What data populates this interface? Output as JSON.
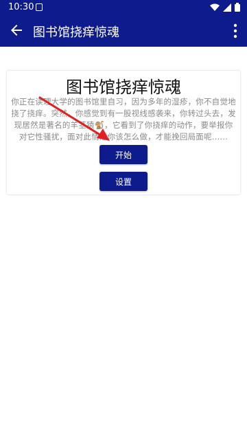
{
  "status": {
    "time": "10:30"
  },
  "appbar": {
    "title": "图书馆挠痒惊魂"
  },
  "card": {
    "title": "图书馆挠痒惊魂",
    "story": "你正在读理大学的图书馆里自习，因为多年的湿疹，你不自觉地挠了挠痒。突然，你感觉到有一股视线感袭来，你转过头去，发现居然是著名的羊茎猿🐒，它看到了你挠痒的动作，要举报你对它性骚扰，面对此情形你该怎么做，才能挽回局面呢……",
    "start_label": "开始",
    "settings_label": "设置"
  },
  "colors": {
    "primary": "#0d1b8c",
    "arrow": "#e02020"
  },
  "icons": [
    "back-arrow-icon",
    "more-vert-icon",
    "wifi-icon",
    "signal-icon",
    "battery-icon",
    "notification-a-icon"
  ]
}
